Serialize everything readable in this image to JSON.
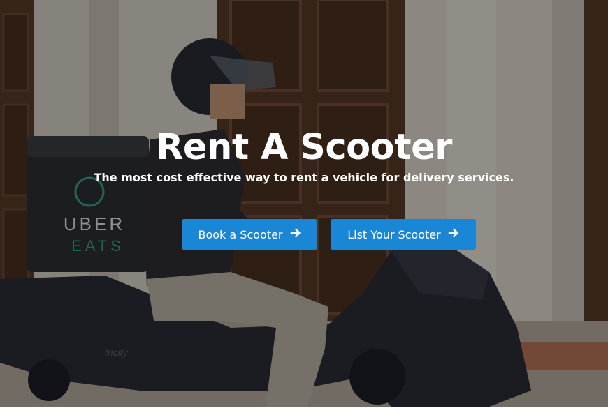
{
  "hero": {
    "title": "Rent A Scooter",
    "subtitle": "The most cost effective way to rent a vehicle for delivery services.",
    "background": {
      "delivery_bag_text_line1": "UBER",
      "delivery_bag_text_line2": "EATS",
      "scooter_model_text": "tricity"
    }
  },
  "buttons": {
    "book_label": "Book a Scooter",
    "list_label": "List Your Scooter",
    "icon": "arrow-right-icon"
  },
  "colors": {
    "button_bg": "#1a87d6",
    "text": "#ffffff",
    "overlay": "rgba(0,0,0,0.38)"
  }
}
